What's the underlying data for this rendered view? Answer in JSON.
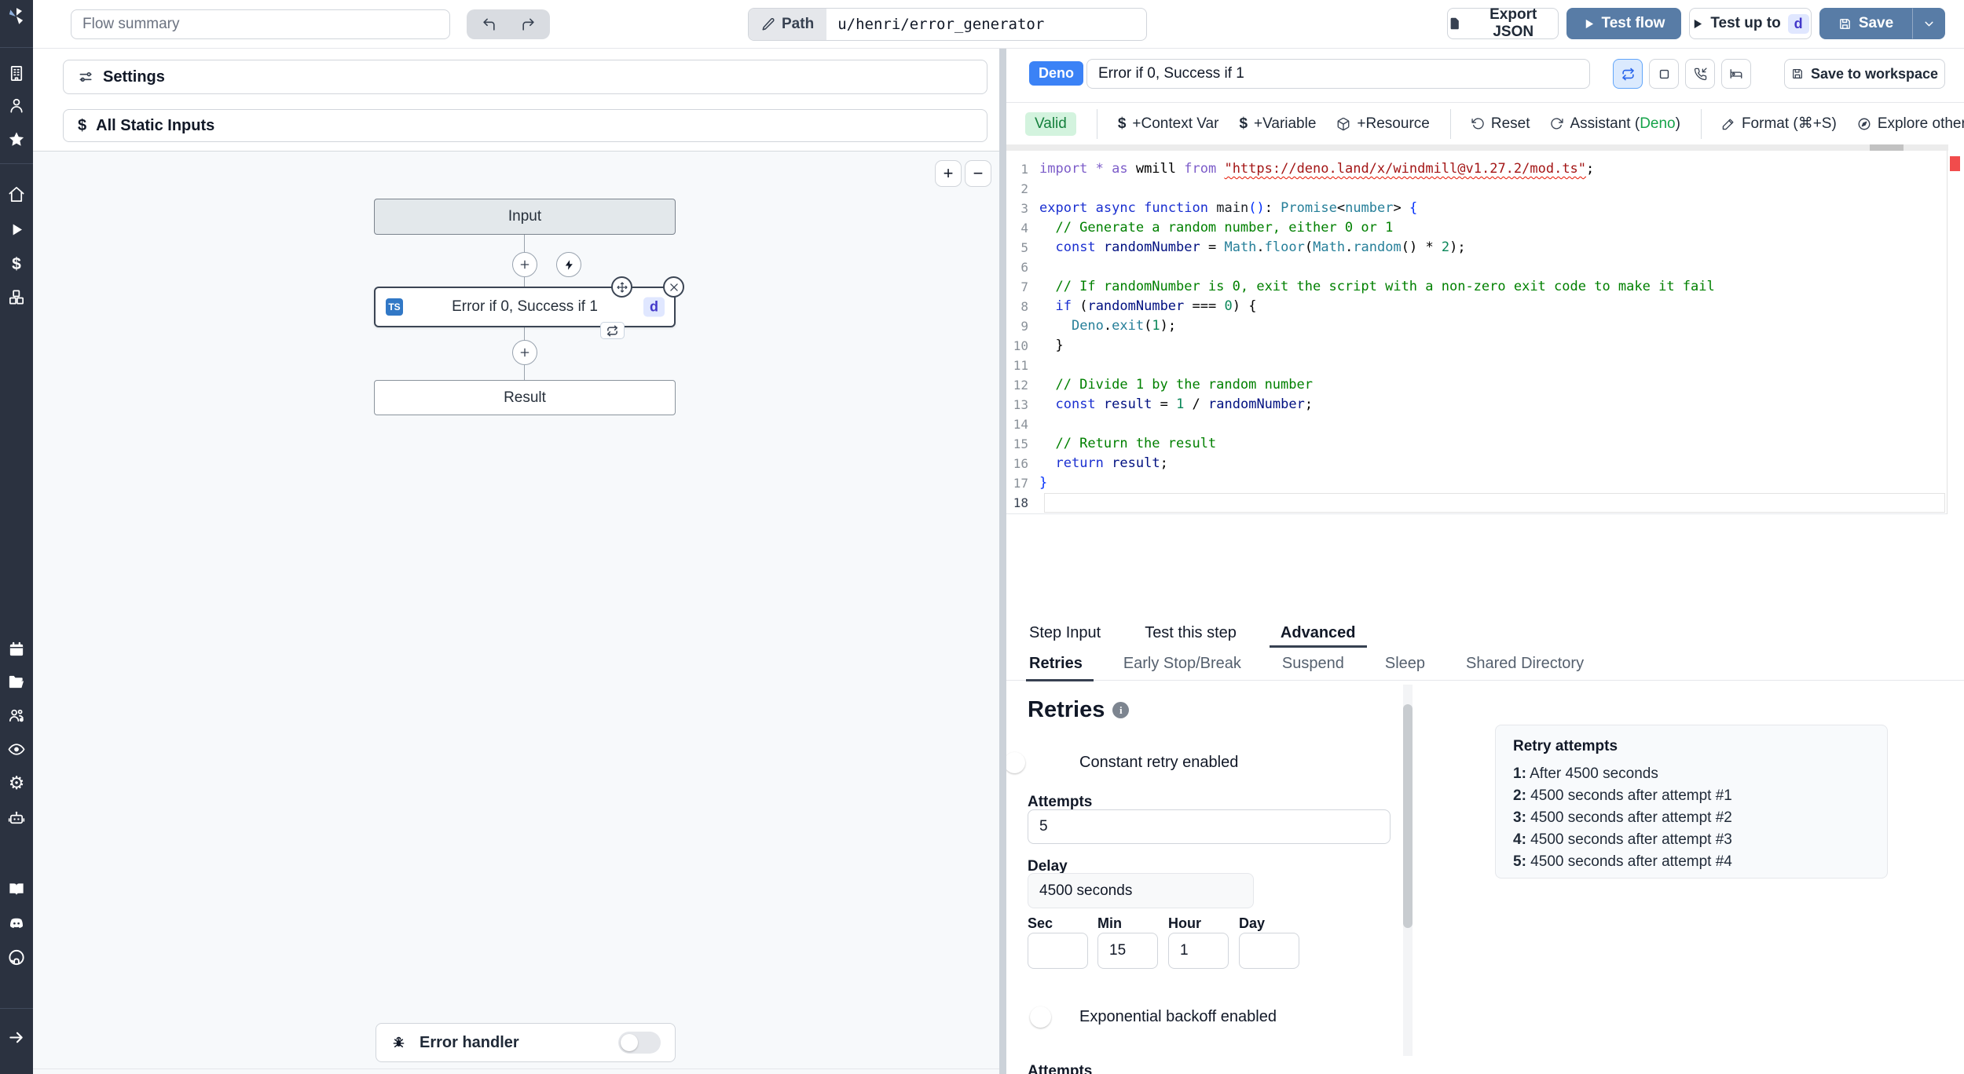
{
  "topbar": {
    "flow_summary_placeholder": "Flow summary",
    "path_label": "Path",
    "path_value": "u/henri/error_generator",
    "export_json": "Export JSON",
    "test_flow": "Test flow",
    "test_up_to": "Test up to",
    "test_up_to_badge": "d",
    "save": "Save"
  },
  "sidebar": {
    "icons": [
      "windmill-logo",
      "building",
      "user",
      "star",
      "home",
      "play",
      "dollar",
      "boxes",
      "calendar",
      "folder-open",
      "user-group",
      "eye",
      "gear",
      "robot",
      "book",
      "discord",
      "github",
      "expand-arrow"
    ]
  },
  "left": {
    "settings": "Settings",
    "all_static_inputs": "All Static Inputs",
    "zoom_in": "+",
    "zoom_out": "−",
    "flow": {
      "input": "Input",
      "step_lang": "TS",
      "step_title": "Error if 0, Success if 1",
      "step_badge": "d",
      "result": "Result",
      "error_handler": "Error handler"
    }
  },
  "editor": {
    "lang_badge": "Deno",
    "title": "Error if 0, Success if 1",
    "save_to_workspace": "Save to workspace",
    "toolbar": {
      "valid": "Valid",
      "context_var": "+Context Var",
      "variable": "+Variable",
      "resource": "+Resource",
      "reset": "Reset",
      "assistant_prefix": "Assistant (",
      "assistant_lang": "Deno",
      "assistant_suffix": ")",
      "format": "Format (⌘+S)",
      "explore": "Explore other s"
    },
    "code": {
      "lines": [
        {
          "n": 1,
          "tokens": [
            [
              "imp",
              "import * as"
            ],
            [
              "pl",
              " wmill "
            ],
            [
              "imp",
              "from"
            ],
            [
              "pl",
              " "
            ],
            [
              "str",
              "\"https://deno.land/x/windmill@v1.27.2/mod.ts\""
            ],
            [
              "pl",
              ";"
            ]
          ]
        },
        {
          "n": 2,
          "tokens": []
        },
        {
          "n": 3,
          "tokens": [
            [
              "kw",
              "export"
            ],
            [
              "pl",
              " "
            ],
            [
              "kw",
              "async"
            ],
            [
              "pl",
              " "
            ],
            [
              "kw",
              "function"
            ],
            [
              "pl",
              " "
            ],
            [
              "fn",
              "main"
            ],
            [
              "br",
              "()"
            ],
            [
              "pl",
              ": "
            ],
            [
              "ty",
              "Promise"
            ],
            [
              "pl",
              "<"
            ],
            [
              "ty",
              "number"
            ],
            [
              "pl",
              "> "
            ],
            [
              "br",
              "{"
            ]
          ]
        },
        {
          "n": 4,
          "tokens": [
            [
              "com",
              "  // Generate a random number, either 0 or 1"
            ]
          ]
        },
        {
          "n": 5,
          "tokens": [
            [
              "pl",
              "  "
            ],
            [
              "kw",
              "const"
            ],
            [
              "pl",
              " "
            ],
            [
              "vr",
              "randomNumber"
            ],
            [
              "pl",
              " = "
            ],
            [
              "ty",
              "Math"
            ],
            [
              "pl",
              "."
            ],
            [
              "ty",
              "floor"
            ],
            [
              "pl",
              "("
            ],
            [
              "ty",
              "Math"
            ],
            [
              "pl",
              "."
            ],
            [
              "ty",
              "random"
            ],
            [
              "pl",
              "() * "
            ],
            [
              "num",
              "2"
            ],
            [
              "pl",
              ");"
            ]
          ]
        },
        {
          "n": 6,
          "tokens": []
        },
        {
          "n": 7,
          "tokens": [
            [
              "com",
              "  // If randomNumber is 0, exit the script with a non-zero exit code to make it fail"
            ]
          ]
        },
        {
          "n": 8,
          "tokens": [
            [
              "pl",
              "  "
            ],
            [
              "kw",
              "if"
            ],
            [
              "pl",
              " ("
            ],
            [
              "vr",
              "randomNumber"
            ],
            [
              "pl",
              " === "
            ],
            [
              "num",
              "0"
            ],
            [
              "pl",
              ") {"
            ]
          ]
        },
        {
          "n": 9,
          "tokens": [
            [
              "pl",
              "    "
            ],
            [
              "ty",
              "Deno"
            ],
            [
              "pl",
              "."
            ],
            [
              "ty",
              "exit"
            ],
            [
              "pl",
              "("
            ],
            [
              "num",
              "1"
            ],
            [
              "pl",
              ");"
            ]
          ]
        },
        {
          "n": 10,
          "tokens": [
            [
              "pl",
              "  }"
            ]
          ]
        },
        {
          "n": 11,
          "tokens": []
        },
        {
          "n": 12,
          "tokens": [
            [
              "com",
              "  // Divide 1 by the random number"
            ]
          ]
        },
        {
          "n": 13,
          "tokens": [
            [
              "pl",
              "  "
            ],
            [
              "kw",
              "const"
            ],
            [
              "pl",
              " "
            ],
            [
              "vr",
              "result"
            ],
            [
              "pl",
              " = "
            ],
            [
              "num",
              "1"
            ],
            [
              "pl",
              " / "
            ],
            [
              "vr",
              "randomNumber"
            ],
            [
              "pl",
              ";"
            ]
          ]
        },
        {
          "n": 14,
          "tokens": []
        },
        {
          "n": 15,
          "tokens": [
            [
              "com",
              "  // Return the result"
            ]
          ]
        },
        {
          "n": 16,
          "tokens": [
            [
              "pl",
              "  "
            ],
            [
              "kw",
              "return"
            ],
            [
              "pl",
              " "
            ],
            [
              "vr",
              "result"
            ],
            [
              "pl",
              ";"
            ]
          ]
        },
        {
          "n": 17,
          "tokens": [
            [
              "br",
              "}"
            ]
          ]
        },
        {
          "n": 18,
          "cur": true,
          "tokens": []
        }
      ]
    }
  },
  "panel": {
    "tabs": [
      "Step Input",
      "Test this step",
      "Advanced"
    ],
    "subtabs": [
      "Retries",
      "Early Stop/Break",
      "Suspend",
      "Sleep",
      "Shared Directory"
    ],
    "retries": {
      "heading": "Retries",
      "constant_label": "Constant retry enabled",
      "attempts_label": "Attempts",
      "attempts_value": "5",
      "delay_label": "Delay",
      "delay_value": "4500 seconds",
      "sec_label": "Sec",
      "min_label": "Min",
      "hour_label": "Hour",
      "day_label": "Day",
      "sec_value": "",
      "min_value": "15",
      "hour_value": "1",
      "day_value": "",
      "exponential_label": "Exponential backoff enabled",
      "clipped_label": "Attempts"
    },
    "retry_preview": {
      "title": "Retry attempts",
      "items": [
        {
          "n": "1:",
          "t": "After 4500 seconds"
        },
        {
          "n": "2:",
          "t": "4500 seconds after attempt #1"
        },
        {
          "n": "3:",
          "t": "4500 seconds after attempt #2"
        },
        {
          "n": "4:",
          "t": "4500 seconds after attempt #3"
        },
        {
          "n": "5:",
          "t": "4500 seconds after attempt #4"
        }
      ]
    }
  },
  "colors": {
    "sidebar_bg": "#2b3240",
    "accent_steel_blue": "#587ca6",
    "deno_badge_blue": "#3b82f6",
    "toggle_on_blue": "#2563eb",
    "valid_bg": "#d3f3de",
    "valid_text": "#15803d",
    "assistant_green": "#16a34a",
    "ts_badge_blue": "#3178c6",
    "d_badge_bg": "#e0e7ff",
    "d_badge_text": "#4338ca",
    "error_marker_red": "#f14c4c"
  }
}
